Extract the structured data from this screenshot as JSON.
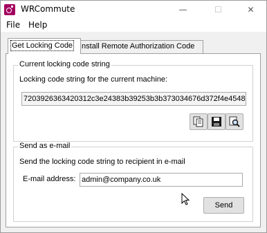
{
  "window": {
    "title": "WRCommute",
    "minimize_glyph": "—",
    "maximize_glyph": "☐",
    "close_glyph": "✕"
  },
  "menu": {
    "file": "File",
    "help": "Help"
  },
  "tabs": [
    {
      "label": "Get Locking Code",
      "active": true
    },
    {
      "label": "Install Remote Authorization Code",
      "active": false
    }
  ],
  "locking_group": {
    "title": "Current locking code string",
    "description": "Locking code string for the current machine:",
    "code_value": "7203926363420312c3e24383b39253b3b373034676d372f4e4548",
    "buttons": [
      "copy-icon",
      "save-icon",
      "view-icon"
    ]
  },
  "email_group": {
    "title": "Send as e-mail",
    "description": "Send the locking code string to recipient in e-mail",
    "email_label": "E-mail address:",
    "email_value": "admin@company.co.uk",
    "send_label": "Send"
  },
  "colors": {
    "app_icon": "#a3005f",
    "window_bg": "#f0f0f0"
  }
}
